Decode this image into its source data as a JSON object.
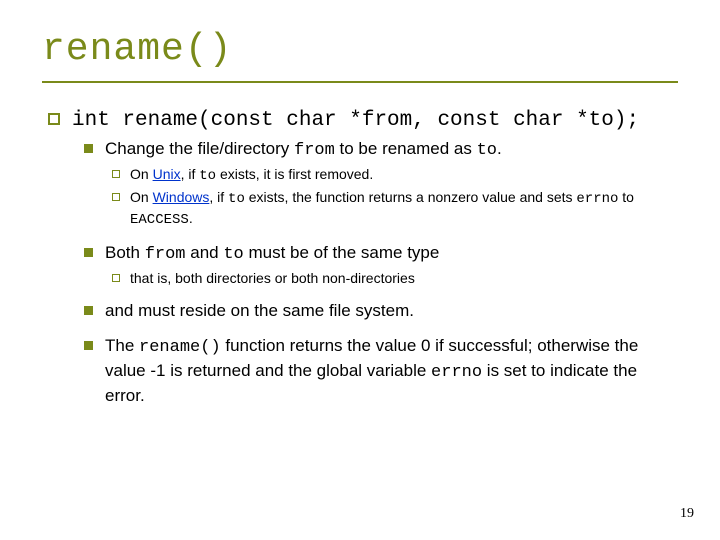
{
  "title": "rename()",
  "signature": "int rename(const char *from, const char *to);",
  "b1": {
    "pre": "Change the file/directory ",
    "code1": "from",
    "mid": " to be renamed as ",
    "code2": "to",
    "post": "."
  },
  "b1_1": {
    "pre": "On ",
    "link": "Unix",
    "mid1": ", if ",
    "code": "to",
    "mid2": " exists, it is first removed."
  },
  "b1_2": {
    "pre": "On ",
    "link": "Windows",
    "mid1": ", if ",
    "code": "to",
    "mid2": " exists, the function returns a nonzero value and sets ",
    "code2": "errno",
    "mid3": " to ",
    "code3": "EACCESS",
    "post": "."
  },
  "b2": {
    "pre": "Both ",
    "code1": "from",
    "mid": " and ",
    "code2": "to",
    "post": " must be of the same type"
  },
  "b2_1": "that is, both directories or both non-directories",
  "b3": "and must reside on the same file system.",
  "b4": {
    "pre": "The ",
    "code1": "rename()",
    "mid1": "  function returns the value 0 if successful; otherwise the value -1 is returned and the global variable ",
    "code2": "errno",
    "post": " is set to indicate the error."
  },
  "page": "19"
}
